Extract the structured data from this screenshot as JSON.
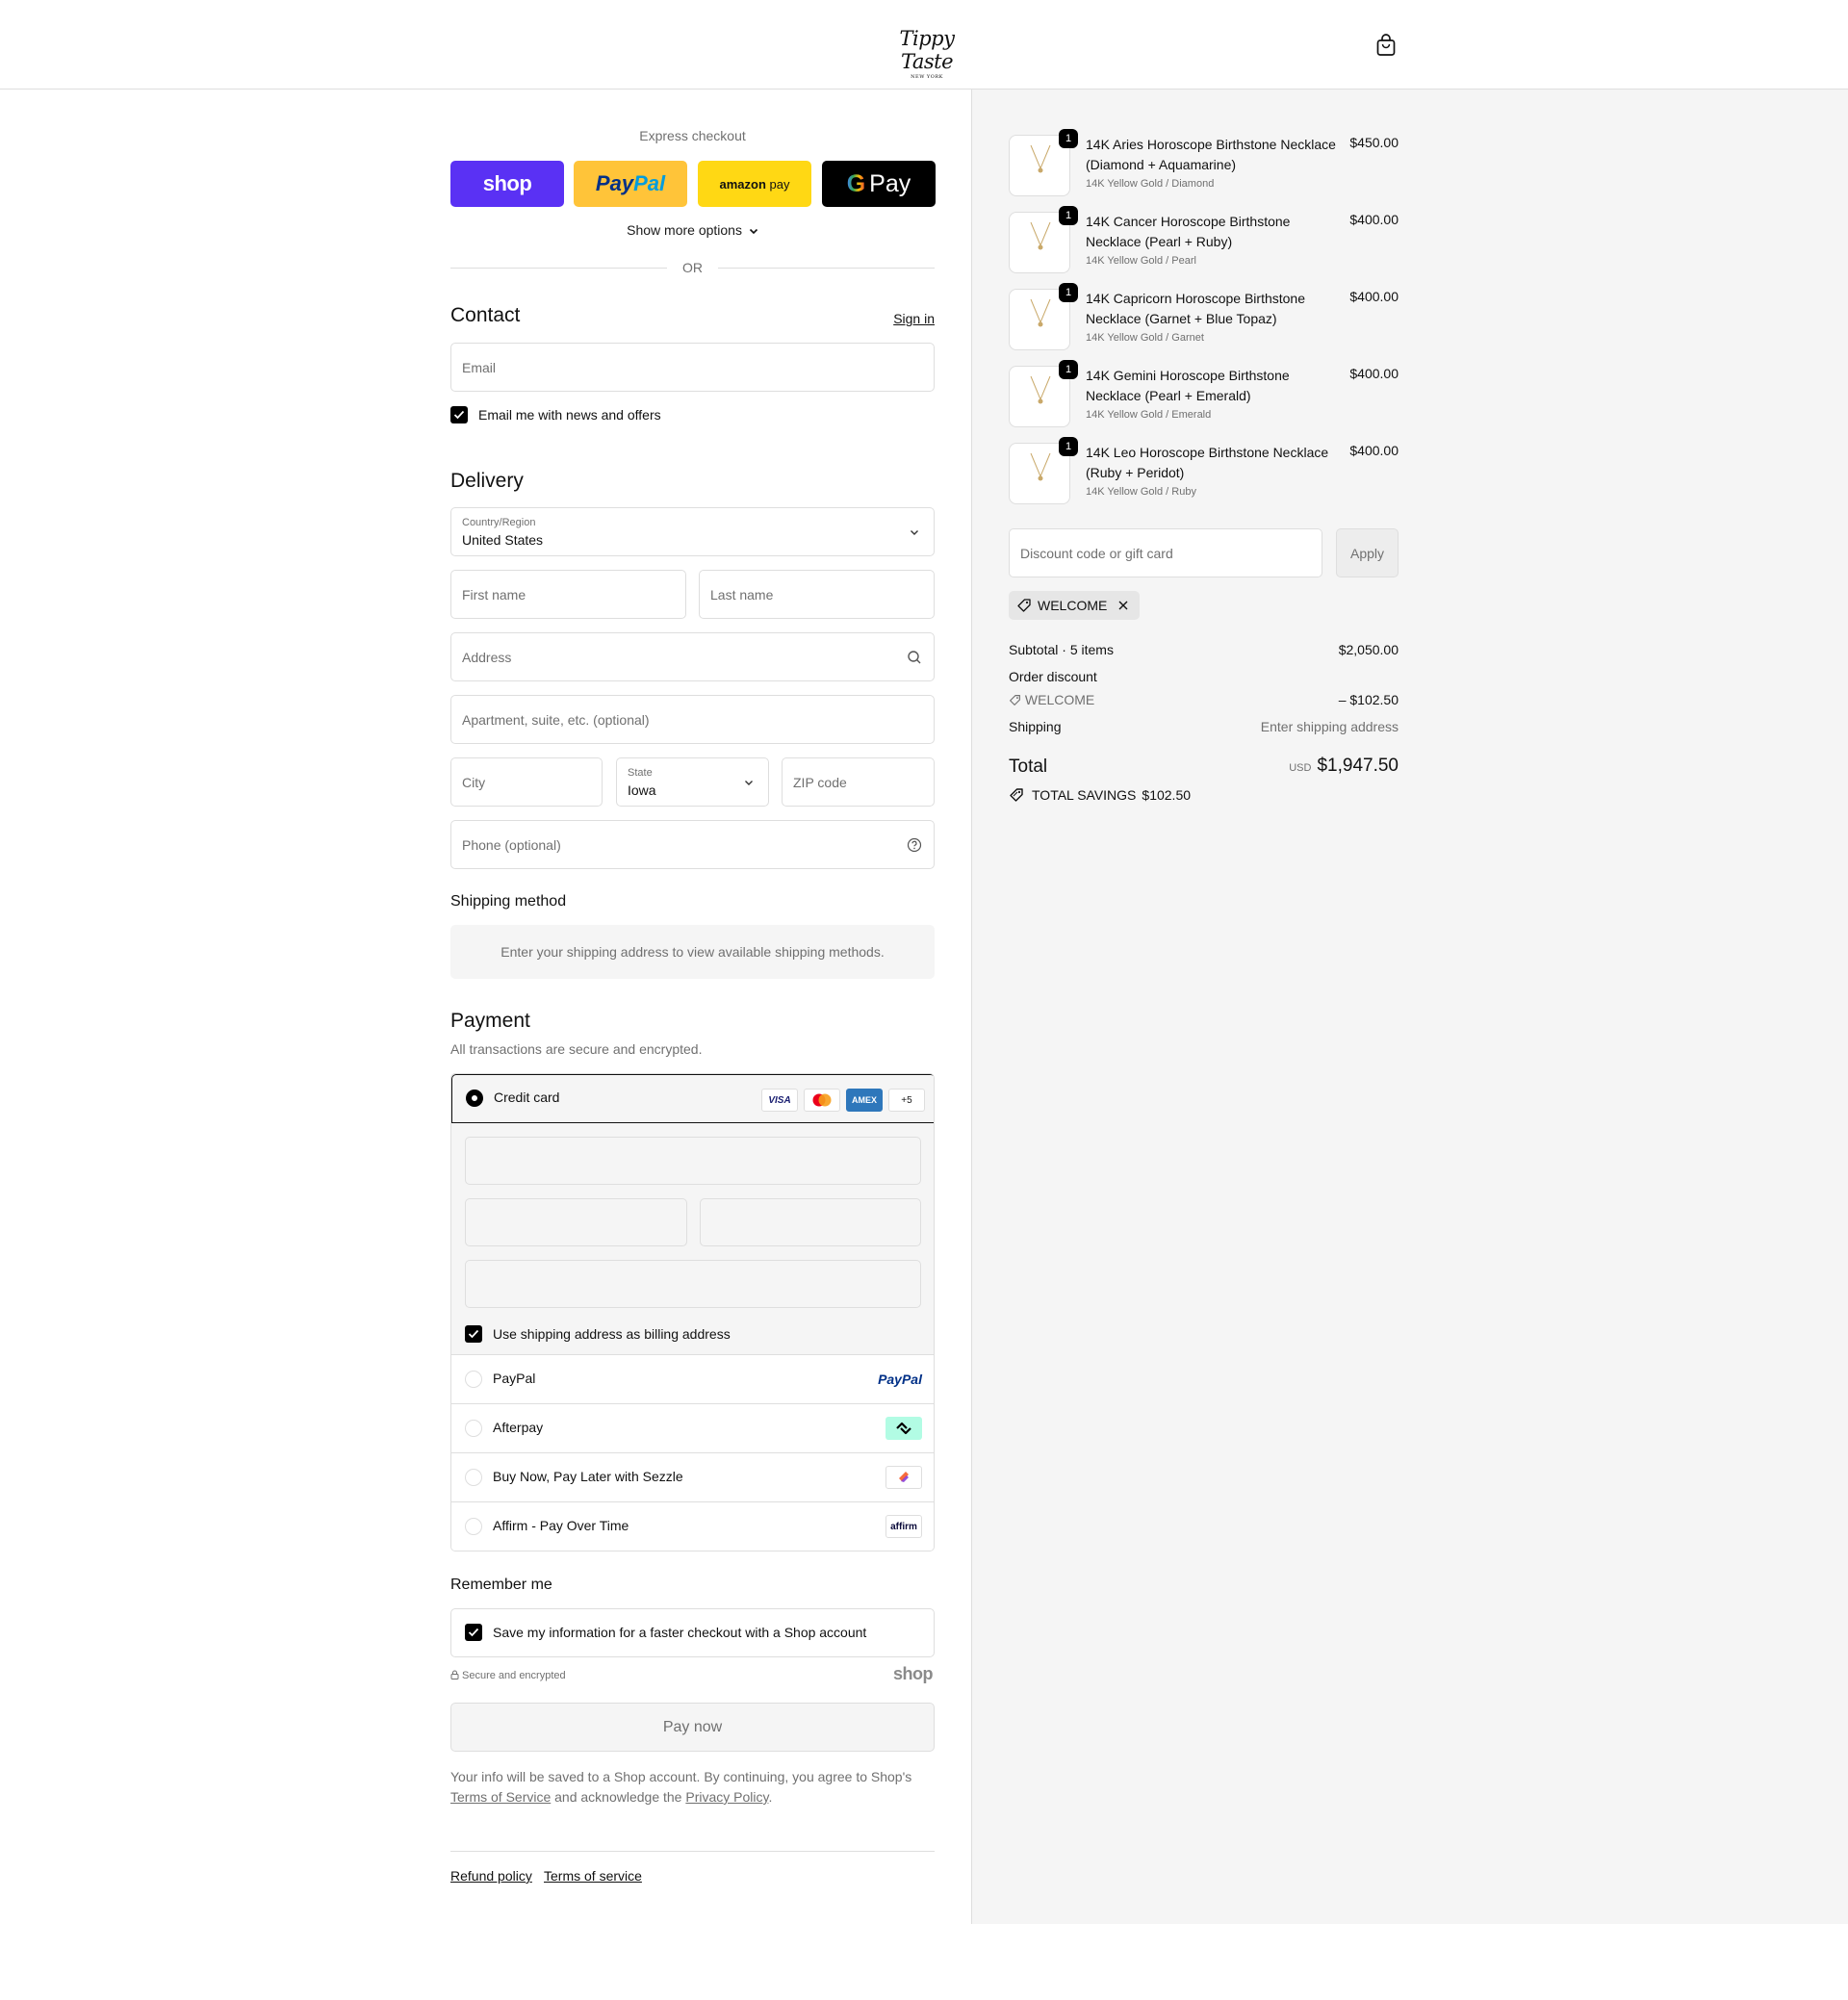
{
  "header": {
    "logo_main": "Tippy Taste",
    "logo_sub": "NEW YORK",
    "cart_icon": "shopping-bag-icon"
  },
  "express": {
    "label": "Express checkout",
    "shop_label": "shop",
    "paypal_label_1": "Pay",
    "paypal_label_2": "Pal",
    "amazon_label_1": "amazon",
    "amazon_label_2": "pay",
    "gpay_label_1": "G",
    "gpay_label_2": "Pay",
    "show_more": "Show more options",
    "or": "OR"
  },
  "contact": {
    "title": "Contact",
    "sign_in": "Sign in",
    "email_placeholder": "Email",
    "news_label": "Email me with news and offers"
  },
  "delivery": {
    "title": "Delivery",
    "country_label": "Country/Region",
    "country_value": "United States",
    "first_name_placeholder": "First name",
    "last_name_placeholder": "Last name",
    "address_placeholder": "Address",
    "apartment_placeholder": "Apartment, suite, etc. (optional)",
    "city_placeholder": "City",
    "state_label": "State",
    "state_value": "Iowa",
    "zip_placeholder": "ZIP code",
    "phone_placeholder": "Phone (optional)"
  },
  "shipping_method": {
    "title": "Shipping method",
    "message": "Enter your shipping address to view available shipping methods."
  },
  "payment": {
    "title": "Payment",
    "subtitle": "All transactions are secure and encrypted.",
    "credit_card_label": "Credit card",
    "brands": [
      "VISA",
      "AMEX",
      "+5"
    ],
    "billing_label": "Use shipping address as billing address",
    "options": [
      {
        "label": "PayPal",
        "logo": "PayPal"
      },
      {
        "label": "Afterpay",
        "logo": "afterpay-icon"
      },
      {
        "label": "Buy Now, Pay Later with Sezzle",
        "logo": "sezzle-icon"
      },
      {
        "label": "Affirm - Pay Over Time",
        "logo": "affirm"
      }
    ]
  },
  "remember": {
    "title": "Remember me",
    "save_label": "Save my information for a faster checkout with a Shop account",
    "secure": "Secure and encrypted",
    "shop_mark": "shop"
  },
  "paynow": {
    "label": "Pay now",
    "legal_1": "Your info will be saved to a Shop account. By continuing, you agree to Shop's",
    "tos": "Terms of Service",
    "legal_2": "and acknowledge the",
    "privacy": "Privacy Policy",
    "legal_3": "."
  },
  "footer": {
    "refund": "Refund policy",
    "terms": "Terms of service"
  },
  "summary": {
    "items": [
      {
        "name": "14K Aries Horoscope Birthstone Necklace (Diamond + Aquamarine)",
        "variant": "14K Yellow Gold / Diamond",
        "price": "$450.00",
        "qty": "1"
      },
      {
        "name": "14K Cancer Horoscope Birthstone Necklace (Pearl + Ruby)",
        "variant": "14K Yellow Gold / Pearl",
        "price": "$400.00",
        "qty": "1"
      },
      {
        "name": "14K Capricorn Horoscope Birthstone Necklace (Garnet + Blue Topaz)",
        "variant": "14K Yellow Gold / Garnet",
        "price": "$400.00",
        "qty": "1"
      },
      {
        "name": "14K Gemini Horoscope Birthstone Necklace (Pearl + Emerald)",
        "variant": "14K Yellow Gold / Emerald",
        "price": "$400.00",
        "qty": "1"
      },
      {
        "name": "14K Leo Horoscope Birthstone Necklace (Ruby + Peridot)",
        "variant": "14K Yellow Gold / Ruby",
        "price": "$400.00",
        "qty": "1"
      }
    ],
    "discount_placeholder": "Discount code or gift card",
    "apply": "Apply",
    "code": "WELCOME",
    "subtotal_label": "Subtotal · 5 items",
    "subtotal_value": "$2,050.00",
    "order_discount_label": "Order discount",
    "discount_code": "WELCOME",
    "discount_value": "– $102.50",
    "shipping_label": "Shipping",
    "shipping_value": "Enter shipping address",
    "total_label": "Total",
    "currency": "USD",
    "total_value": "$1,947.50",
    "savings_label": "TOTAL SAVINGS",
    "savings_value": "$102.50"
  }
}
